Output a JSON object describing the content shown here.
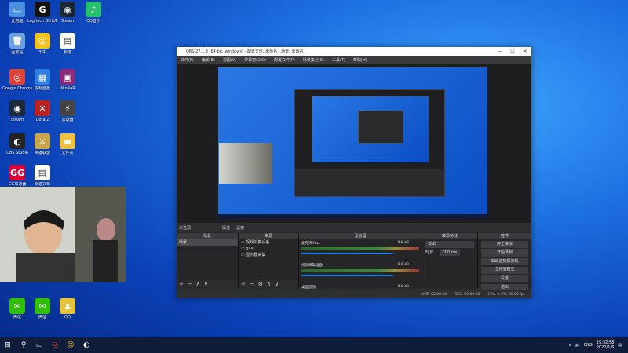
{
  "desktop": {
    "icons": [
      {
        "label": "此电脑",
        "icon": "pc-icon",
        "color": "#4a90e2",
        "glyph": "▭"
      },
      {
        "label": "Logitech G HUB",
        "icon": "logitech-icon",
        "color": "#111",
        "glyph": "G"
      },
      {
        "label": "Steam",
        "icon": "steam-icon",
        "color": "#1b2838",
        "glyph": "◉"
      },
      {
        "label": "QQ音乐",
        "icon": "qqmusic-icon",
        "color": "#25c16f",
        "glyph": "♪"
      },
      {
        "label": "回收站",
        "icon": "recycle-bin-icon",
        "color": "#6aa0e0",
        "glyph": "🗑"
      },
      {
        "label": "千牛",
        "icon": "qianniu-icon",
        "color": "#f5c11b",
        "glyph": "☺"
      },
      {
        "label": "新建",
        "icon": "file-icon",
        "color": "#ffffff",
        "glyph": "▤"
      },
      {
        "label": "Google Chrome",
        "icon": "chrome-icon",
        "color": "#db4437",
        "glyph": "◎"
      },
      {
        "label": "控制面板",
        "icon": "control-panel-icon",
        "color": "#2f7de1",
        "glyph": "▦"
      },
      {
        "label": "WinRAR",
        "icon": "winrar-icon",
        "color": "#8b2a7a",
        "glyph": "▣"
      },
      {
        "label": "Steam",
        "icon": "steam-icon",
        "color": "#1b2838",
        "glyph": "◉"
      },
      {
        "label": "Dota 2",
        "icon": "dota-icon",
        "color": "#b22",
        "glyph": "✕"
      },
      {
        "label": "加速器",
        "icon": "accelerator-icon",
        "color": "#444",
        "glyph": "⚡"
      },
      {
        "label": "OBS Studio",
        "icon": "obs-icon",
        "color": "#222",
        "glyph": "◐"
      },
      {
        "label": "英雄联盟",
        "icon": "lol-icon",
        "color": "#c8a44a",
        "glyph": "⚔"
      },
      {
        "label": "文件夹",
        "icon": "folder-icon",
        "color": "#f0c040",
        "glyph": "▬"
      },
      {
        "label": "GG加速器",
        "icon": "gg-icon",
        "color": "#d03",
        "glyph": "GG"
      },
      {
        "label": "新建文档",
        "icon": "doc-icon",
        "color": "#fff",
        "glyph": "▤"
      },
      {
        "label": "微信",
        "icon": "wechat-icon",
        "color": "#2dc100",
        "glyph": "✉"
      },
      {
        "label": "微信",
        "icon": "wechat-icon",
        "color": "#2dc100",
        "glyph": "✉"
      },
      {
        "label": "QQ",
        "icon": "qq-icon",
        "color": "#e8c23a",
        "glyph": "♟"
      }
    ]
  },
  "obs": {
    "title": "OBS 27.1.3 (64-bit, windows) - 配置文件: 未命名 - 场景: 未命名",
    "menu": [
      "文件(F)",
      "编辑(E)",
      "视图(V)",
      "停靠窗口(D)",
      "配置文件(P)",
      "场景集合(S)",
      "工具(T)",
      "帮助(H)"
    ],
    "scene_bar": {
      "label": "未选源",
      "properties": "属性",
      "filters": "滤镜"
    },
    "docks": {
      "scenes": {
        "title": "场景",
        "items": [
          "场景"
        ]
      },
      "sources": {
        "title": "来源",
        "items": [
          "视频采集设备",
          "gaaj",
          "显示器采集"
        ]
      },
      "mixer": {
        "title": "混音器",
        "tracks": [
          {
            "name": "麦克风/Aux",
            "db": "0.0 dB"
          },
          {
            "name": "视频采集设备",
            "db": "0.0 dB"
          },
          {
            "name": "桌面音频",
            "db": "0.0 dB"
          }
        ]
      },
      "transitions": {
        "title": "转场特效",
        "type": "淡出",
        "duration_label": "时长",
        "duration": "300 ms"
      },
      "controls": {
        "title": "控件",
        "buttons": [
          "停止推流",
          "开始录制",
          "启动虚拟摄像机",
          "工作室模式",
          "设置",
          "退出"
        ]
      }
    },
    "status": {
      "live": "LIVE: 00:00:00",
      "rec": "REC: 00:00:00",
      "cpu": "CPU: 1.5%, 60.00 fps"
    }
  },
  "taskbar": {
    "lang": "ENG",
    "time": "19:32:58",
    "date": "2022/1/6"
  }
}
